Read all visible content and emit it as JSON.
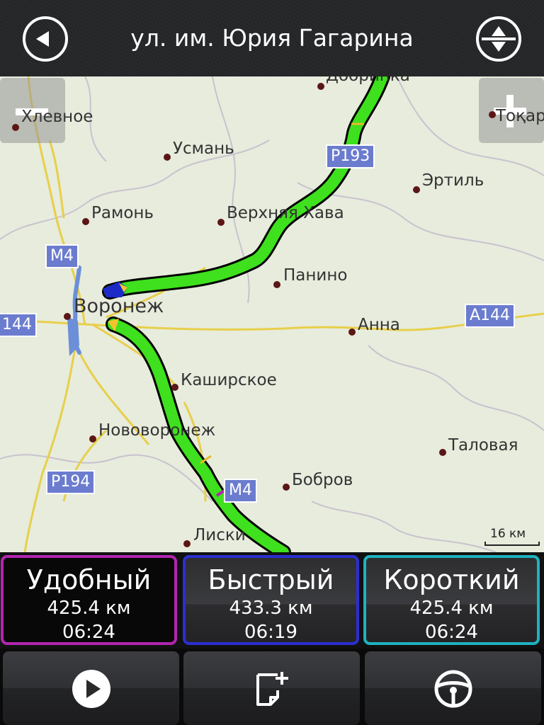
{
  "header": {
    "title": "ул. им. Юрия Гагарина"
  },
  "map": {
    "zoom_out_label": "–",
    "zoom_in_label": "+",
    "cities": [
      {
        "name": "Хлевное"
      },
      {
        "name": "Усмань"
      },
      {
        "name": "Добринка"
      },
      {
        "name": "Тоқаре"
      },
      {
        "name": "Эртиль"
      },
      {
        "name": "Рамонь"
      },
      {
        "name": "Верхняя Хава"
      },
      {
        "name": "Панино"
      },
      {
        "name": "Воронеж"
      },
      {
        "name": "Анна"
      },
      {
        "name": "Каширское"
      },
      {
        "name": "Нововоронеж"
      },
      {
        "name": "Таловая"
      },
      {
        "name": "Бобров"
      },
      {
        "name": "Лиски"
      }
    ],
    "road_shields": [
      "Р193",
      "М4",
      "144",
      "А144",
      "Р194",
      "М4"
    ],
    "scale": "16 км",
    "colors": {
      "route": "#3fe01d",
      "road_yellow": "#e8cf4a",
      "water": "#6c8fd8",
      "shield": "#6b7ccf"
    }
  },
  "routes": [
    {
      "name": "Удобный",
      "distance": "425.4 км",
      "time": "06:24",
      "color": "#b225b0"
    },
    {
      "name": "Быстрый",
      "distance": "433.3 км",
      "time": "06:19",
      "color": "#2b2fd0"
    },
    {
      "name": "Короткий",
      "distance": "425.4 км",
      "time": "06:24",
      "color": "#1fb2bf"
    }
  ],
  "actions": [
    {
      "icon": "play-icon"
    },
    {
      "icon": "note-add-icon"
    },
    {
      "icon": "steering-wheel-icon"
    }
  ]
}
